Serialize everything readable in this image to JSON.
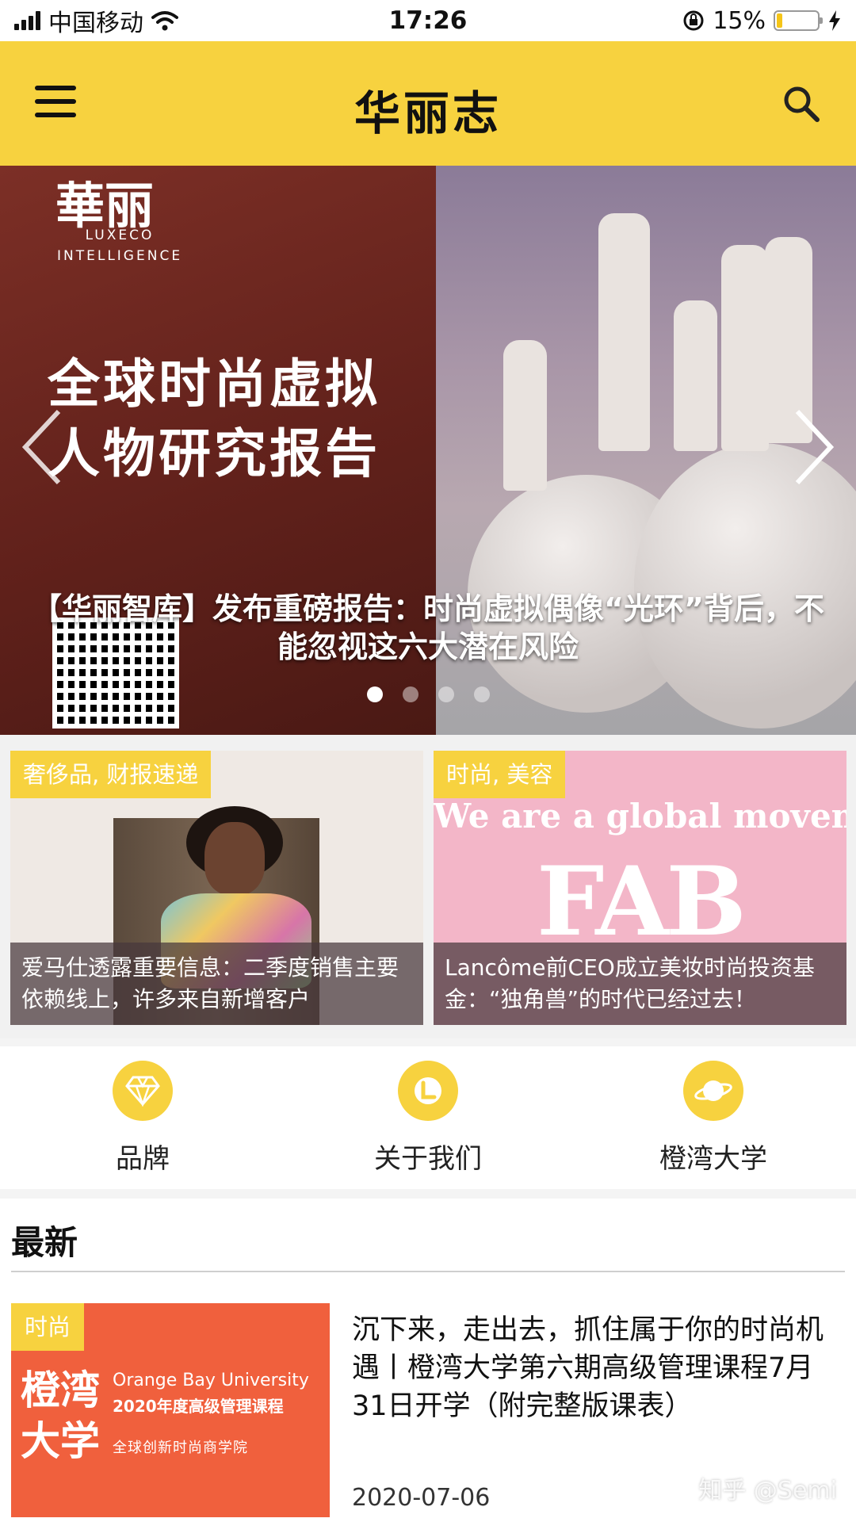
{
  "status_bar": {
    "carrier": "中国移动",
    "time": "17:26",
    "battery_percent": "15%",
    "battery_level": 0.15
  },
  "header": {
    "title": "华丽志",
    "menu_icon": "menu-icon",
    "search_icon": "search-icon",
    "bg_color": "#f7d23f"
  },
  "carousel": {
    "slide_logo": "華丽",
    "slide_logo_sub_1": "LUXECO",
    "slide_logo_sub_2": "INTELLIGENCE",
    "slide_headline_1": "全球时尚虚拟",
    "slide_headline_2": "人物研究报告",
    "caption": "【华丽智库】发布重磅报告：时尚虚拟偶像“光环”背后，不能忽视这六大潜在风险",
    "active_index": 0,
    "dot_count": 4
  },
  "cards": [
    {
      "tag": "奢侈品, 财报速递",
      "title": "爱马仕透露重要信息：二季度销售主要依赖线上，许多来自新增客户"
    },
    {
      "tag": "时尚, 美容",
      "title": "Lancôme前CEO成立美妆时尚投资基金：“独角兽”的时代已经过去！",
      "image_text_1": "We are a global movement",
      "image_text_2": "FAB"
    }
  ],
  "quick_nav": [
    {
      "label": "品牌",
      "icon": "diamond-icon"
    },
    {
      "label": "关于我们",
      "icon": "about-icon"
    },
    {
      "label": "橙湾大学",
      "icon": "planet-icon"
    }
  ],
  "latest": {
    "heading": "最新",
    "articles": [
      {
        "tag": "时尚",
        "thumb_big": "橙湾大学",
        "thumb_en_1": "Orange Bay University",
        "thumb_en_2": "2020年度高级管理课程",
        "thumb_sub": "全球创新时尚商学院",
        "title": "沉下来，走出去，抓住属于你的时尚机遇丨橙湾大学第六期高级管理课程7月31日开学（附完整版课表）",
        "date": "2020-07-06"
      }
    ]
  },
  "watermark": "知乎 @Semi"
}
